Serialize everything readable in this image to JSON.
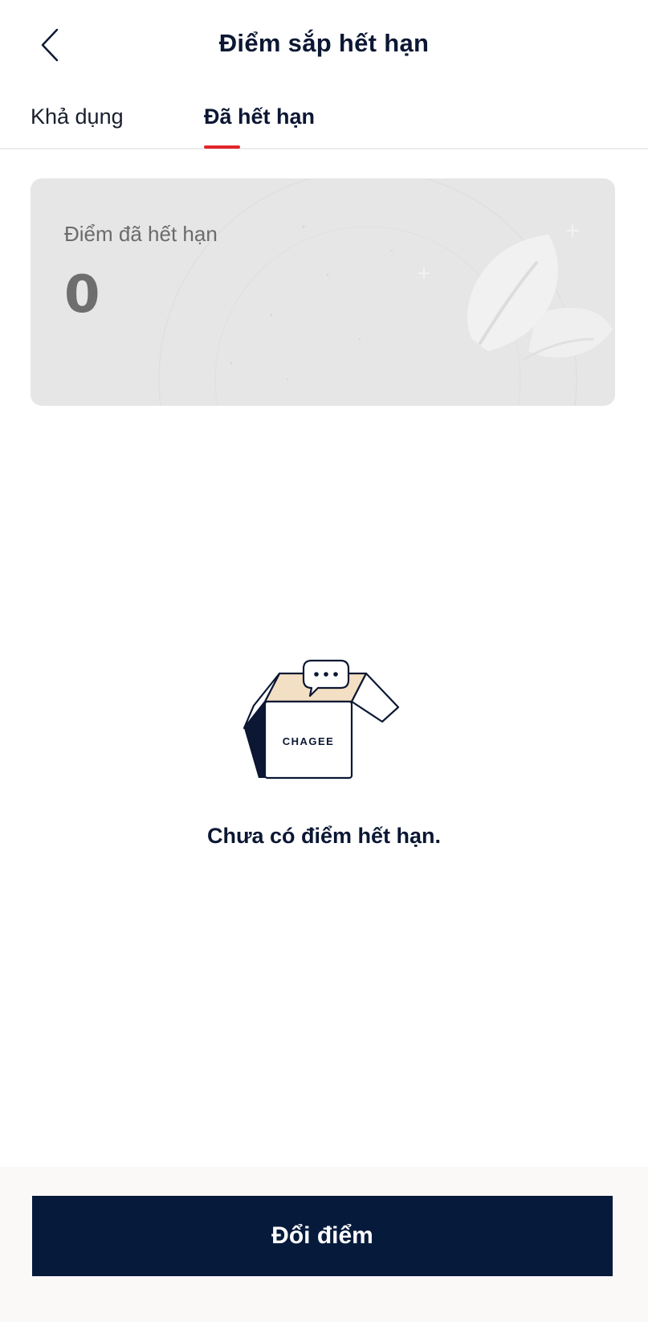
{
  "header": {
    "title": "Điểm sắp hết hạn",
    "back_icon": "chevron-left-icon"
  },
  "tabs": [
    {
      "label": "Khả dụng",
      "active": false
    },
    {
      "label": "Đã hết hạn",
      "active": true
    }
  ],
  "points_card": {
    "label": "Điểm đã hết hạn",
    "value": "0",
    "icon": "leaf-icon"
  },
  "empty_state": {
    "illustration": "empty-box-icon",
    "box_brand": "CHAGEE",
    "message": "Chưa có điểm hết hạn."
  },
  "footer": {
    "button_label": "Đổi điểm"
  },
  "colors": {
    "primary": "#061a3c",
    "accent_red": "#e1252b",
    "card_bg": "#e6e6e6"
  }
}
